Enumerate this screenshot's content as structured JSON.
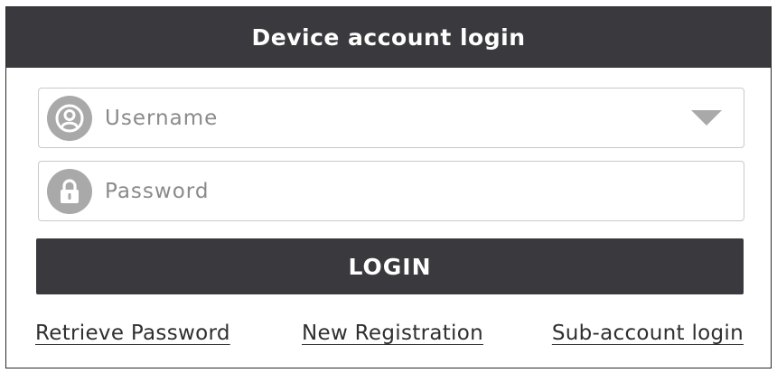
{
  "dialog": {
    "title": "Device account login"
  },
  "username": {
    "placeholder": "Username",
    "icon": "user-icon",
    "dropdown_icon": "triangle-down-icon"
  },
  "password": {
    "placeholder": "Password",
    "icon": "lock-icon"
  },
  "login_button": {
    "label": "LOGIN"
  },
  "links": {
    "retrieve_password": "Retrieve Password",
    "new_registration": "New Registration",
    "sub_account_login": "Sub-account login"
  },
  "colors": {
    "header_bg": "#3a3a3e",
    "button_bg": "#3a3a3e",
    "icon_bg": "#a9a9a9",
    "placeholder_text": "#8a8a8a",
    "field_border": "#c9c9c9"
  }
}
